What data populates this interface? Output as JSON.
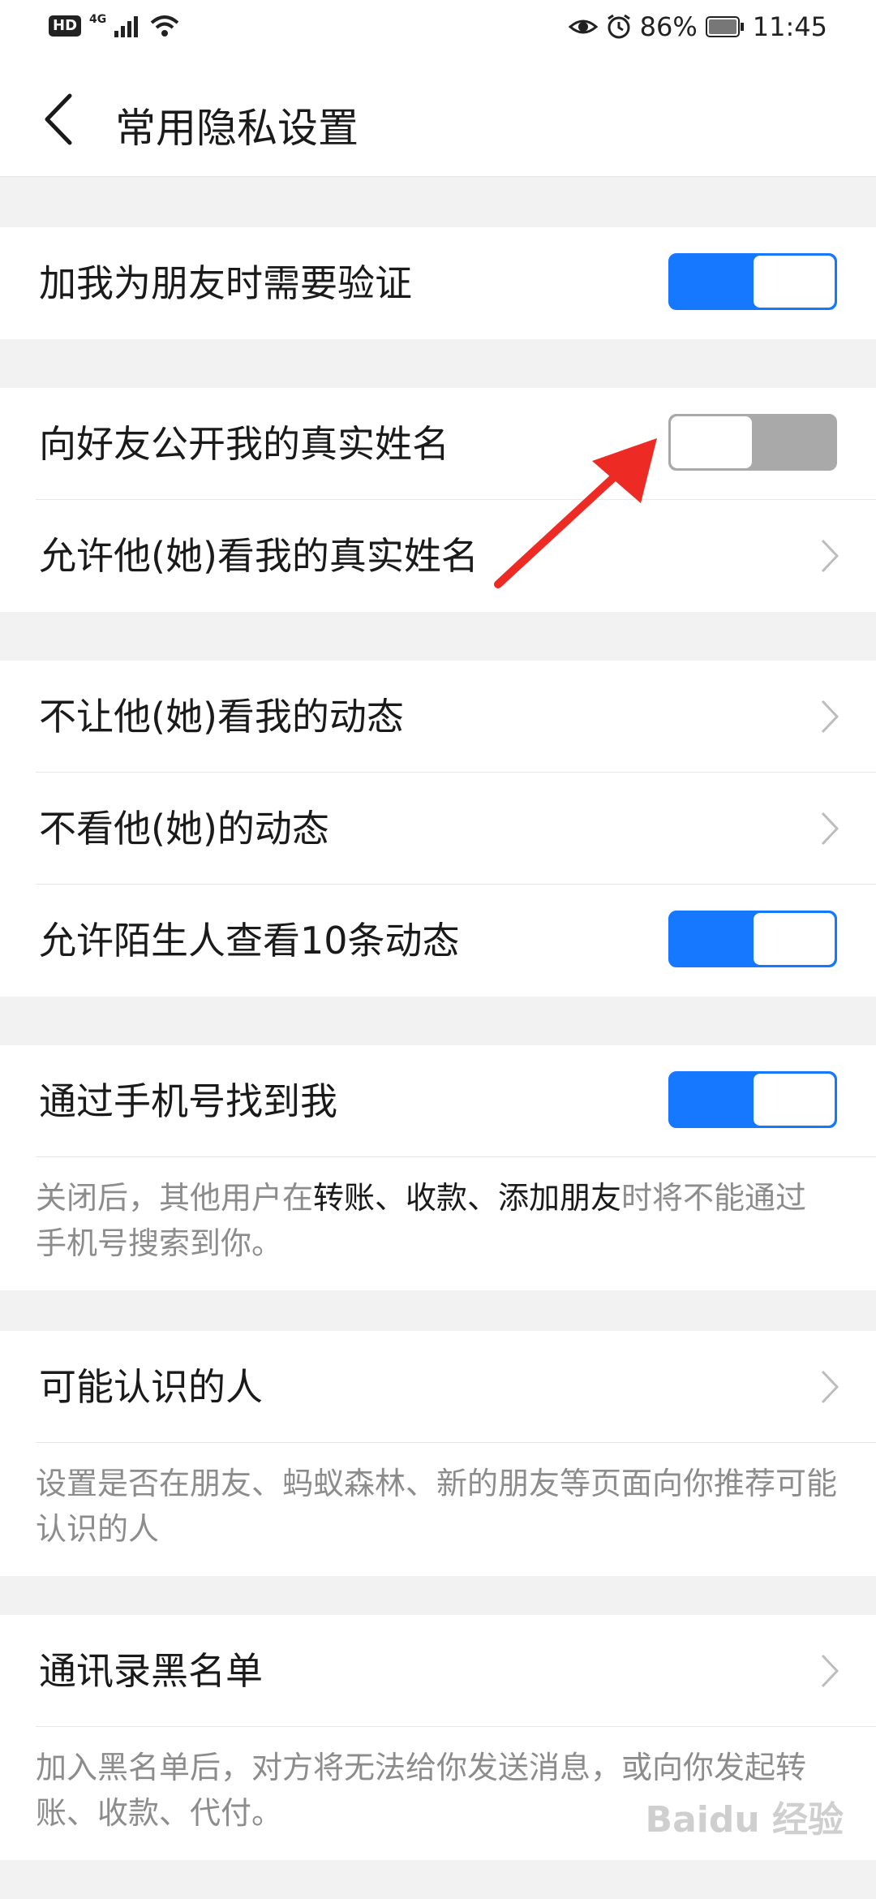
{
  "status_bar": {
    "hd": "HD",
    "network": "4G",
    "battery": "86%",
    "time": "11:45"
  },
  "header": {
    "title": "常用隐私设置"
  },
  "settings": {
    "verify_friend": {
      "label": "加我为朋友时需要验证",
      "enabled": true
    },
    "show_real_name": {
      "label": "向好友公开我的真实姓名",
      "enabled": false
    },
    "allow_see_real_name": {
      "label": "允许他(她)看我的真实姓名"
    },
    "hide_my_moments": {
      "label": "不让他(她)看我的动态"
    },
    "not_see_moments": {
      "label": "不看他(她)的动态"
    },
    "stranger_view": {
      "label": "允许陌生人查看10条动态",
      "enabled": true
    },
    "find_by_phone": {
      "label": "通过手机号找到我",
      "enabled": true,
      "note_prefix": "关闭后，其他用户在",
      "note_highlight": "转账、收款、添加朋友",
      "note_suffix": "时将不能通过手机号搜索到你。"
    },
    "people_may_know": {
      "label": "可能认识的人",
      "note": "设置是否在朋友、蚂蚁森林、新的朋友等页面向你推荐可能认识的人"
    },
    "contacts_blacklist": {
      "label": "通讯录黑名单",
      "note": "加入黑名单后，对方将无法给你发送消息，或向你发起转账、收款、代付。"
    }
  },
  "watermark": "Baidu 经验",
  "colors": {
    "toggle_on": "#1677ff",
    "toggle_off": "#a9a9a9",
    "annotation_arrow": "#ee2a24"
  },
  "icons": [
    "back-arrow-icon",
    "chevron-right-icon",
    "eye-icon",
    "alarm-icon",
    "battery-icon",
    "wifi-icon",
    "signal-icon"
  ]
}
